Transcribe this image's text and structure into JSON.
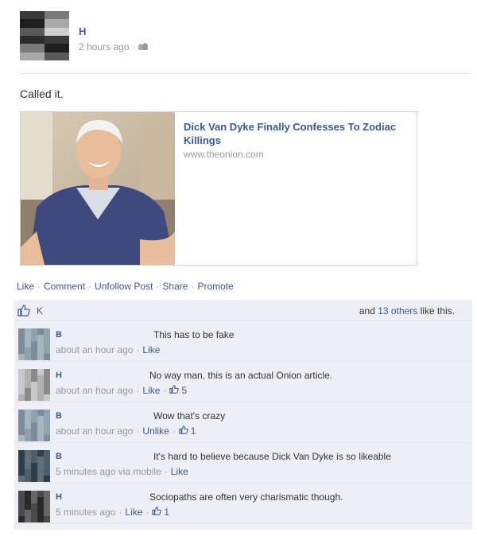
{
  "post": {
    "author": "H",
    "timestamp": "2 hours ago",
    "separator": "·",
    "privacy_icon": "friends-icon",
    "status_text": "Called it."
  },
  "shared_link": {
    "title": "Dick Van Dyke Finally Confesses To Zodiac Killings",
    "url": "www.theonion.com",
    "image": "photo of smiling white-haired man on a couch"
  },
  "actions": {
    "like": "Like",
    "comment": "Comment",
    "unfollow": "Unfollow Post",
    "share": "Share",
    "promote": "Promote",
    "separator": "·"
  },
  "likes": {
    "icon": "thumbs-up-icon",
    "first_liker": "K",
    "prefix": "and",
    "others_link": "13 others",
    "suffix": "like this."
  },
  "comments": [
    {
      "author": "B",
      "text": "This has to be fake",
      "time": "about an hour ago",
      "action": "Like",
      "like_count": ""
    },
    {
      "author": "H",
      "text": "No way man, this is an actual Onion article.",
      "time": "about an hour ago",
      "action": "Like",
      "like_count": "5"
    },
    {
      "author": "B",
      "text": "Wow that's crazy",
      "time": "about an hour ago",
      "action": "Unlike",
      "like_count": "1"
    },
    {
      "author": "B",
      "text": "It's hard to believe because Dick Van Dyke is so likeable",
      "time": "5 minutes ago via mobile",
      "action": "Like",
      "like_count": ""
    },
    {
      "author": "H",
      "text": "Sociopaths are often very charismatic though.",
      "time": "5 minutes ago",
      "action": "Like",
      "like_count": "1"
    }
  ],
  "colors": {
    "link": "#3b5998",
    "meta": "#999999",
    "feedback_bg": "#edeff4"
  }
}
